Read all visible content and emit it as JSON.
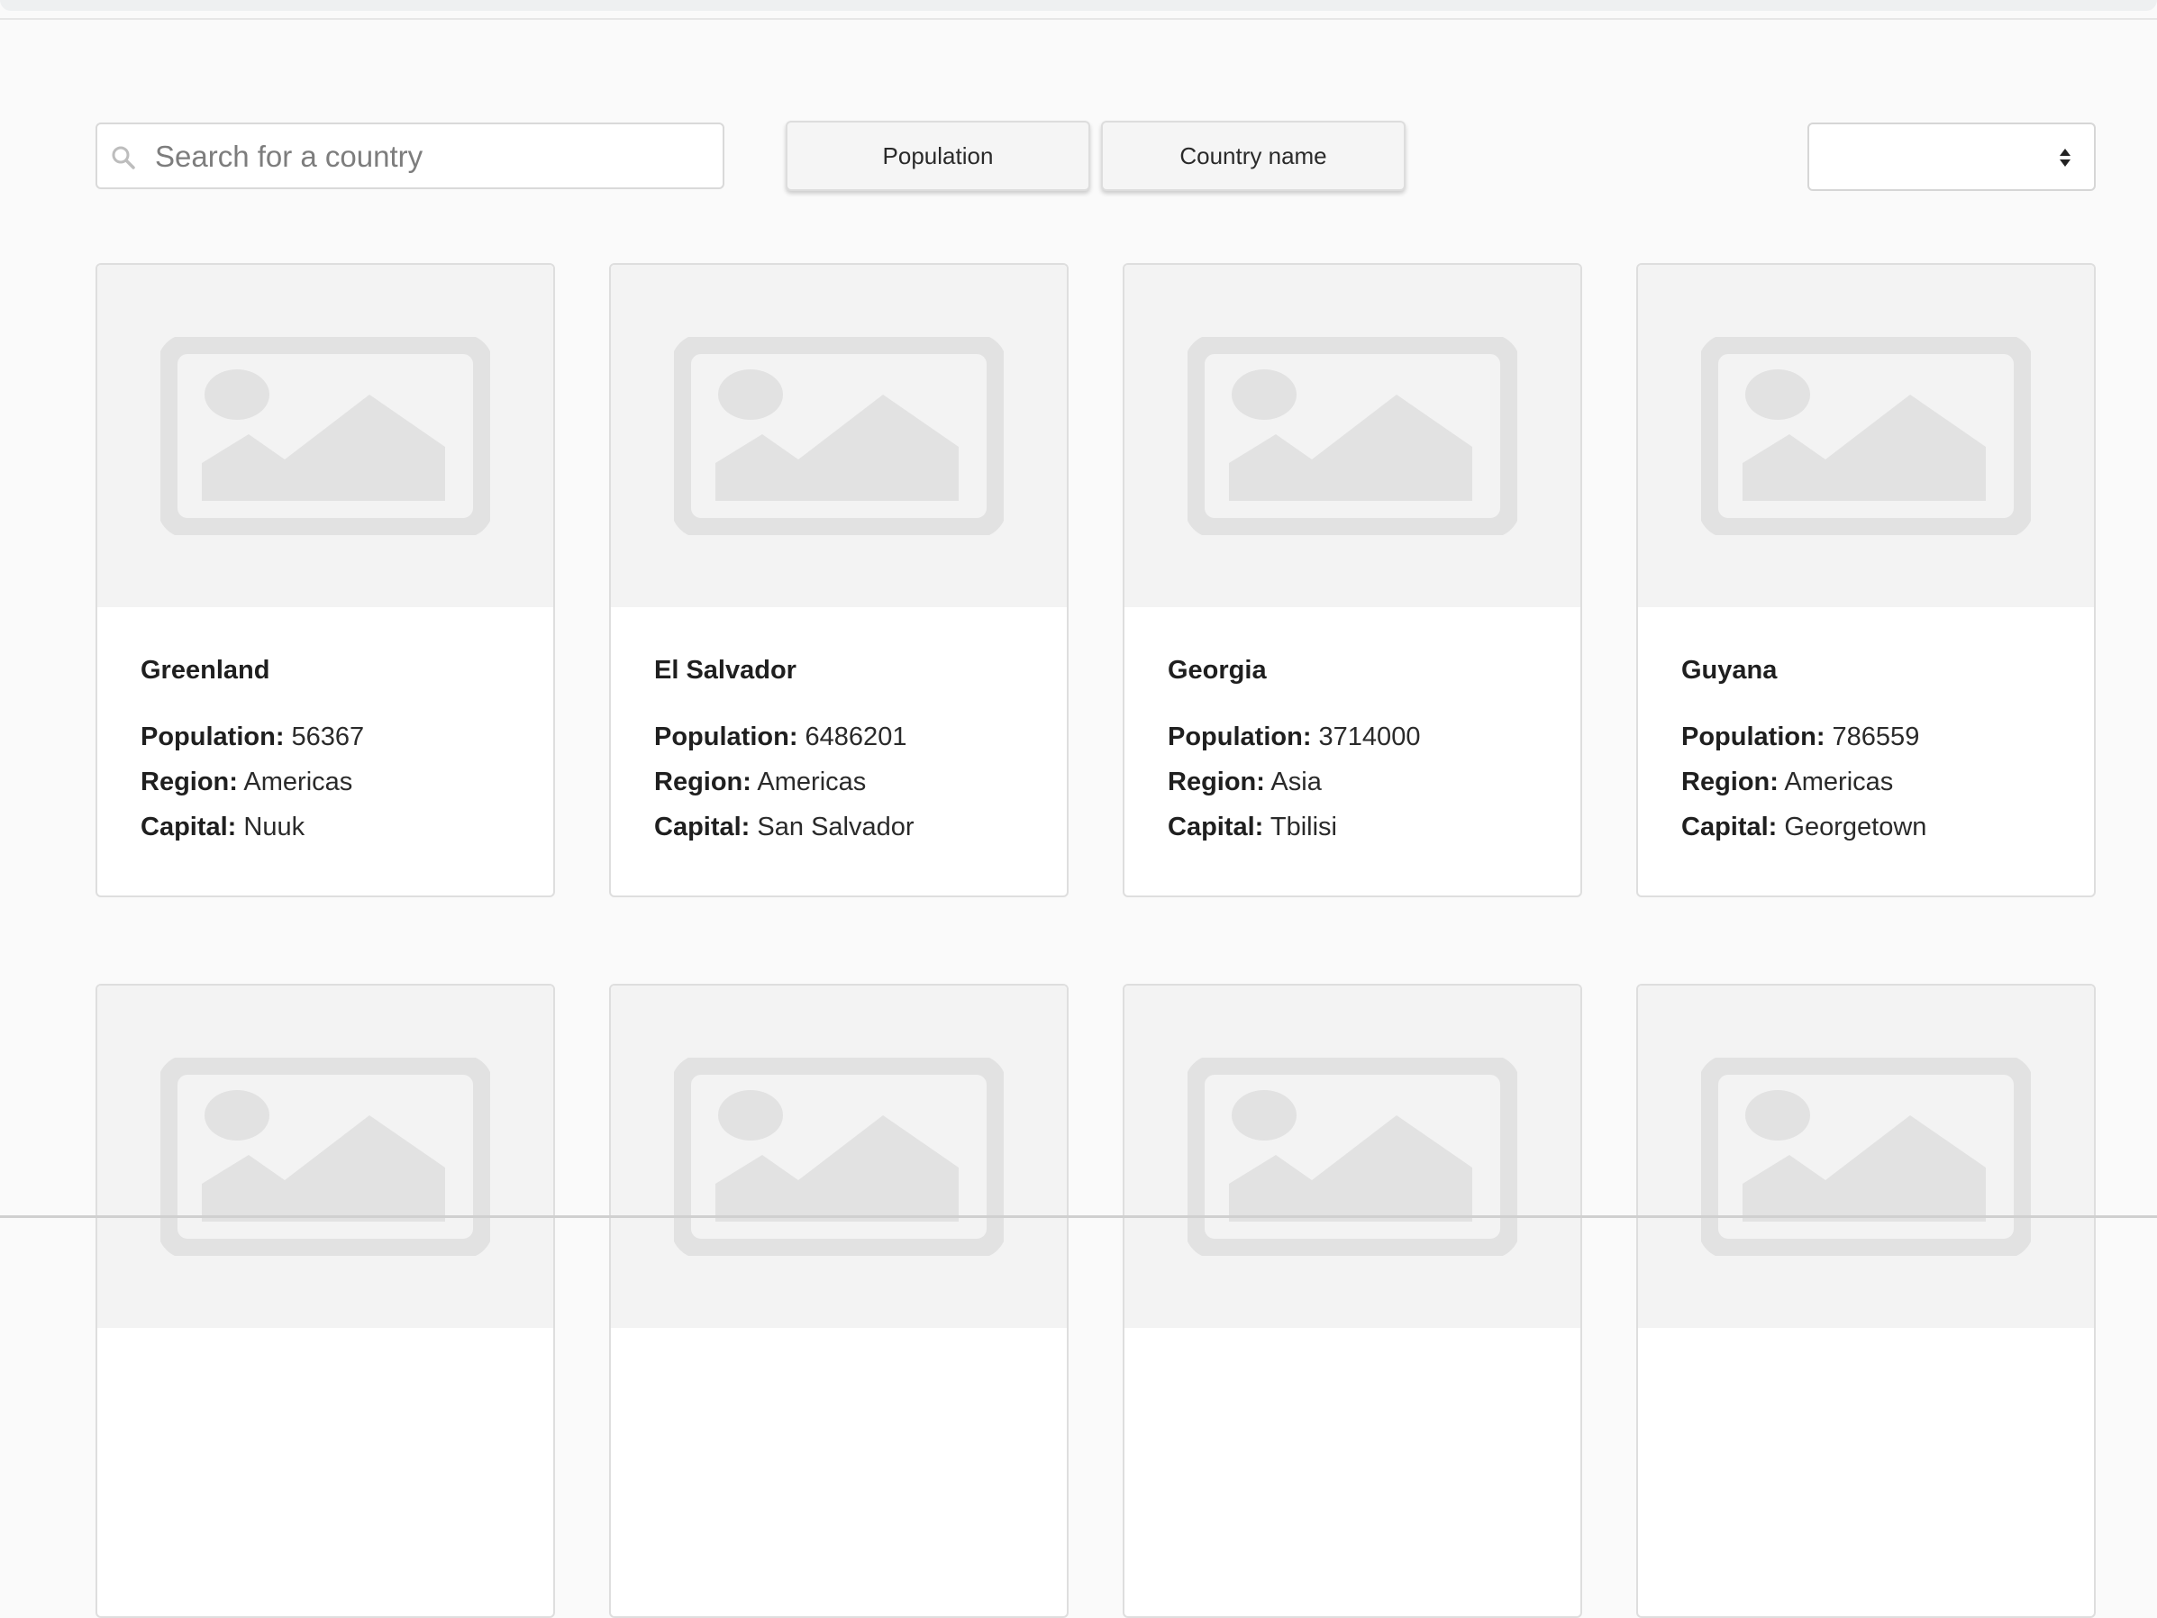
{
  "search": {
    "placeholder": "Search for a country",
    "icon": "search-icon"
  },
  "sort_buttons": {
    "population_label": "Population",
    "country_name_label": "Country name"
  },
  "region_select": {
    "selected": ""
  },
  "labels": {
    "population": "Population:",
    "region": "Region:",
    "capital": "Capital:"
  },
  "countries": [
    {
      "name": "Greenland",
      "population": "56367",
      "region": "Americas",
      "capital": "Nuuk"
    },
    {
      "name": "El Salvador",
      "population": "6486201",
      "region": "Americas",
      "capital": "San Salvador"
    },
    {
      "name": "Georgia",
      "population": "3714000",
      "region": "Asia",
      "capital": "Tbilisi"
    },
    {
      "name": "Guyana",
      "population": "786559",
      "region": "Americas",
      "capital": "Georgetown"
    }
  ],
  "colors": {
    "background": "#fafafa",
    "card": "#ffffff",
    "placeholder_bg": "#f3f3f3",
    "placeholder_icon": "#e2e2e2"
  }
}
